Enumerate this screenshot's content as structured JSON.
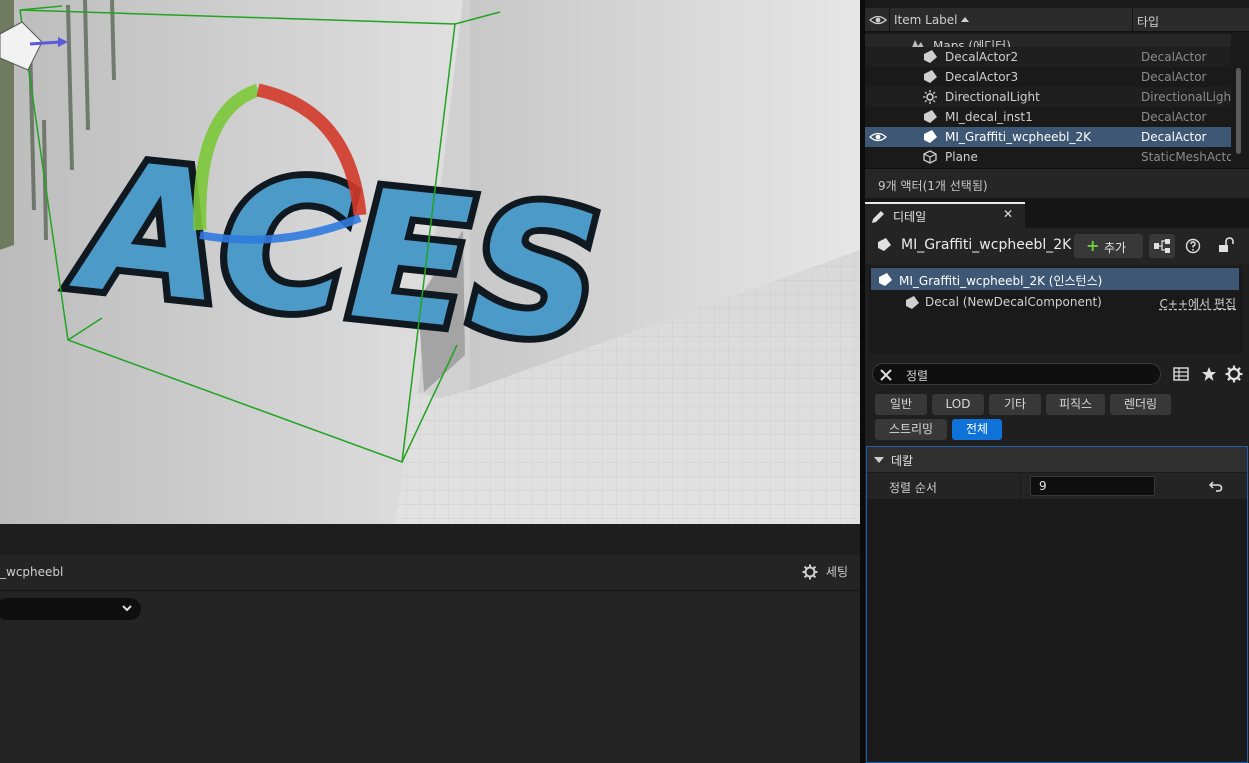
{
  "viewport": {
    "graffiti_text": "ACES"
  },
  "bottom_panel": {
    "title": "_wcpheebl",
    "settings_label": "세팅"
  },
  "outliner": {
    "col_label": "Item Label",
    "col_type": "타입",
    "maps_label": "Maps (에디터)",
    "rows": [
      {
        "label": "DecalActor2",
        "type": "DecalActor"
      },
      {
        "label": "DecalActor3",
        "type": "DecalActor"
      },
      {
        "label": "DirectionalLight",
        "type": "DirectionalLight"
      },
      {
        "label": "MI_decal_inst1",
        "type": "DecalActor"
      },
      {
        "label": "MI_Graffiti_wcpheebl_2K",
        "type": "DecalActor"
      },
      {
        "label": "Plane",
        "type": "StaticMeshActor"
      }
    ],
    "footer": "9개 액터(1개 선택됨)"
  },
  "details": {
    "tab_label": "디테일",
    "tab_close": "✕",
    "actor_name": "MI_Graffiti_wcpheebl_2K",
    "add_label": "추가",
    "add_plus": "+",
    "component_root": "MI_Graffiti_wcpheebl_2K (인스턴스)",
    "component_child": "Decal (NewDecalComponent)",
    "cpp_link": "C++에서 편집",
    "search_text": "정렬",
    "filters": [
      "일반",
      "LOD",
      "기타",
      "피직스",
      "렌더링",
      "스트리밍",
      "전체"
    ],
    "active_filter": "전체",
    "category": "데칼",
    "property_name": "정렬 순서",
    "property_value": "9"
  },
  "colors": {
    "accent_blue": "#0f72d8",
    "selection": "#3d5774",
    "gizmo_red": "#d23a2a",
    "gizmo_green": "#7cc83a",
    "gizmo_blue": "#2f7ae0",
    "bounds_green": "#22a322"
  }
}
